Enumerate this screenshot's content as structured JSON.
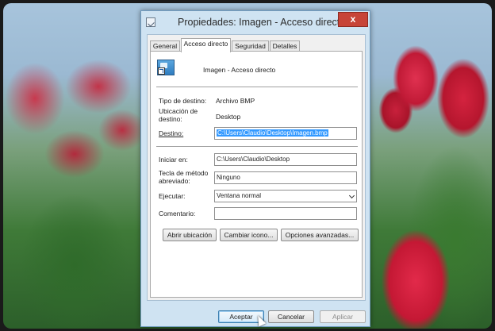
{
  "window": {
    "title": "Propiedades: Imagen - Acceso directo",
    "close_glyph": "x"
  },
  "tabs": [
    {
      "label": "General",
      "active": false
    },
    {
      "label": "Acceso directo",
      "active": true
    },
    {
      "label": "Seguridad",
      "active": false
    },
    {
      "label": "Detalles",
      "active": false
    }
  ],
  "shortcut": {
    "icon": "image-shortcut-icon",
    "name": "Imagen - Acceso directo"
  },
  "info": {
    "tipo_label": "Tipo de destino:",
    "tipo_value": "Archivo BMP",
    "ubicacion_label_1": "Ubicación de",
    "ubicacion_label_2": "destino:",
    "ubicacion_value": "Desktop",
    "destino_label": "Destino:",
    "destino_value": "C:\\Users\\Claudio\\Desktop\\Imagen.bmp"
  },
  "fields": {
    "iniciar_label": "Iniciar en:",
    "iniciar_value": "C:\\Users\\Claudio\\Desktop",
    "tecla_label_1": "Tecla de método",
    "tecla_label_2": "abreviado:",
    "tecla_value": "Ninguno",
    "ejecutar_label": "Ejecutar:",
    "ejecutar_value": "Ventana normal",
    "comentario_label": "Comentario:",
    "comentario_value": ""
  },
  "action_buttons": {
    "abrir": "Abrir ubicación",
    "cambiar": "Cambiar icono...",
    "avanzadas": "Opciones avanzadas..."
  },
  "footer_buttons": {
    "aceptar": "Aceptar",
    "cancelar": "Cancelar",
    "aplicar": "Aplicar"
  }
}
